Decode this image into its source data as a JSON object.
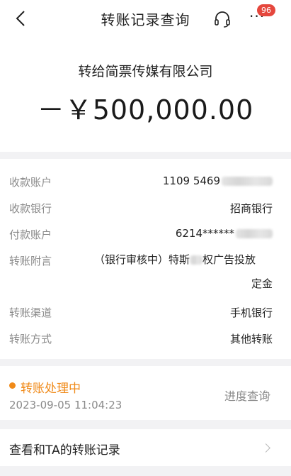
{
  "nav": {
    "title": "转账记录查询",
    "back_icon": "chevron-left-icon",
    "support_icon": "headset-icon",
    "more_label": "···",
    "badge_count": "96"
  },
  "hero": {
    "payee": "转给简票传媒有限公司",
    "amount": "－￥500,000.00"
  },
  "details": {
    "receive_account": {
      "label": "收款账户",
      "value_prefix": "1109 5469"
    },
    "receive_bank": {
      "label": "收款银行",
      "value": "招商银行"
    },
    "pay_account": {
      "label": "付款账户",
      "value_prefix": "6214******"
    },
    "remark": {
      "label": "转账附言",
      "line1_a": "（银行审核中）特斯",
      "line1_b": "权广告投放",
      "line2": "定金"
    },
    "channel": {
      "label": "转账渠道",
      "value": "手机银行"
    },
    "method": {
      "label": "转账方式",
      "value": "其他转账"
    }
  },
  "status": {
    "state": "转账处理中",
    "time": "2023-09-05 11:04:23",
    "progress_label": "进度查询"
  },
  "records": {
    "label": "查看和TA的转账记录"
  },
  "colors": {
    "accent_orange": "#f08a19",
    "badge_red": "#e5473d",
    "background": "#f2f2f4"
  }
}
